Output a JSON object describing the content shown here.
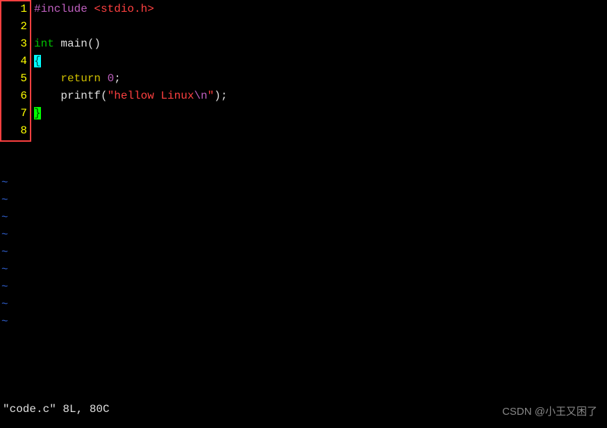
{
  "lines": {
    "numbers": [
      "1",
      "2",
      "3",
      "4",
      "5",
      "6",
      "7",
      "8"
    ]
  },
  "code": {
    "line1": {
      "preproc": "#include ",
      "header": "<stdio.h>"
    },
    "line3": {
      "type": "int",
      "space": " ",
      "func": "main",
      "parens": "()"
    },
    "line4": {
      "brace": "{"
    },
    "line5": {
      "indent": "    ",
      "keyword": "return",
      "space": " ",
      "value": "0",
      "semi": ";"
    },
    "line6": {
      "indent": "    ",
      "func": "printf",
      "open": "(",
      "quote1": "\"",
      "str": "hellow Linux",
      "escape": "\\n",
      "quote2": "\"",
      "close": ")",
      "semi": ";"
    },
    "line7": {
      "brace": "}"
    }
  },
  "tildes": [
    "~",
    "~",
    "~",
    "~",
    "~",
    "~",
    "~",
    "~",
    "~"
  ],
  "status": "\"code.c\" 8L, 80C",
  "watermark": "CSDN @小王又困了"
}
